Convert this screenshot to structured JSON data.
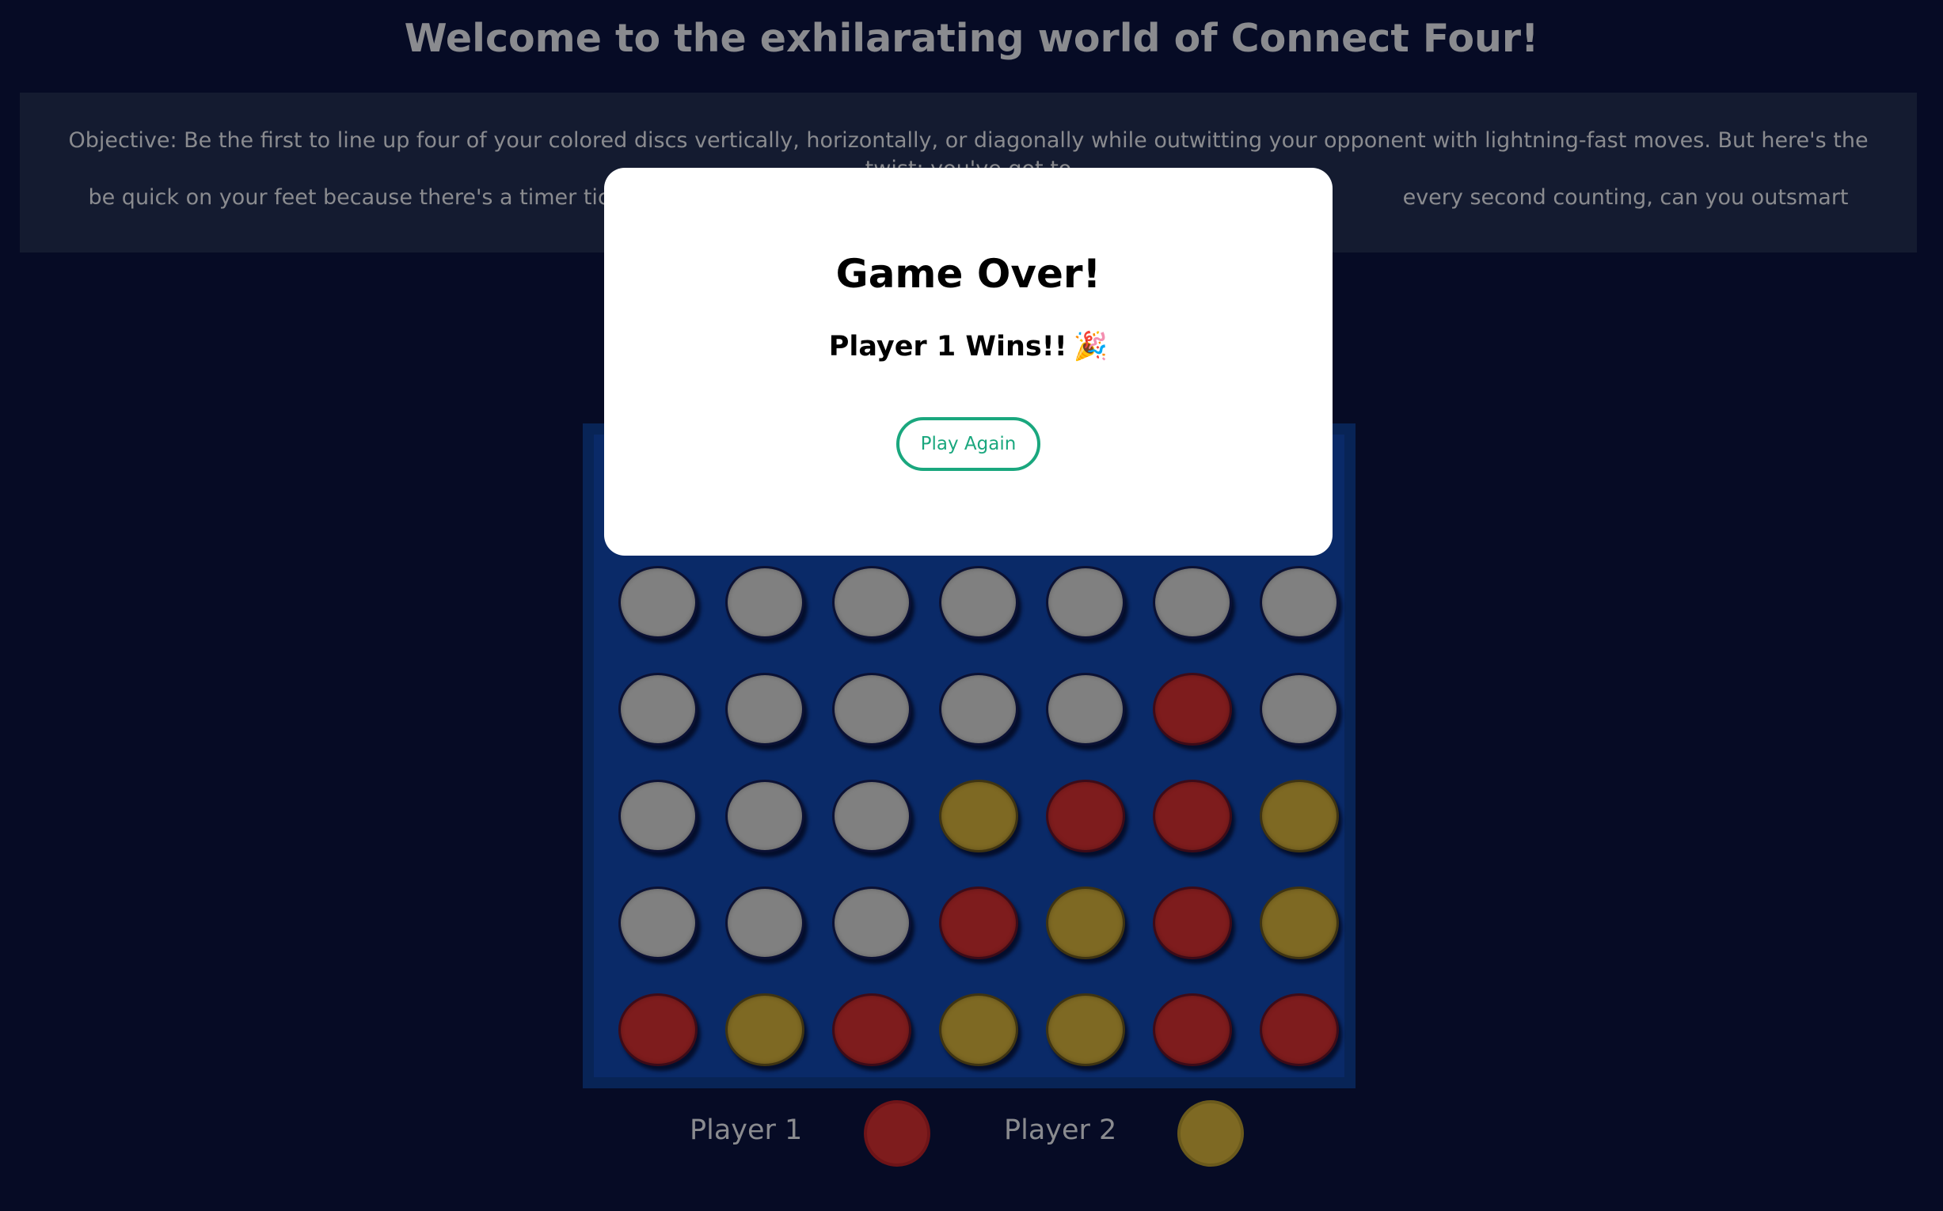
{
  "header": {
    "title": "Welcome to the exhilarating world of Connect Four!"
  },
  "objective": {
    "line1": "Objective: Be the first to line up four of your colored discs vertically, horizontally, or diagonally while outwitting your opponent with lightning-fast moves. But here's the twist: you've got to",
    "line2": "be quick on your feet because there's a timer ticking aw",
    "line2_right": "every second counting, can you outsmart your rival and"
  },
  "board": {
    "columns": 7,
    "visible_rows": [
      [
        "empty",
        "empty",
        "empty",
        "empty",
        "empty",
        "empty",
        "empty"
      ],
      [
        "empty",
        "empty",
        "empty",
        "empty",
        "empty",
        "p1",
        "empty"
      ],
      [
        "empty",
        "empty",
        "empty",
        "p2",
        "p1",
        "p1",
        "p2"
      ],
      [
        "empty",
        "empty",
        "empty",
        "p1",
        "p2",
        "p1",
        "p2"
      ],
      [
        "p1",
        "p2",
        "p1",
        "p2",
        "p2",
        "p1",
        "p1"
      ]
    ]
  },
  "legend": {
    "player1_label": "Player 1",
    "player2_label": "Player 2"
  },
  "colors": {
    "background": "#060b25",
    "board": "#0a2a68",
    "player1_disc": "#7e1c1d",
    "player2_disc": "#7e6923",
    "empty_slot": "#808080",
    "accent": "#1aa77e"
  },
  "modal": {
    "title": "Game Over!",
    "message": "Player 1 Wins!!",
    "icon": "party-popper-icon",
    "icon_glyph": "🎉",
    "button_label": "Play Again"
  }
}
